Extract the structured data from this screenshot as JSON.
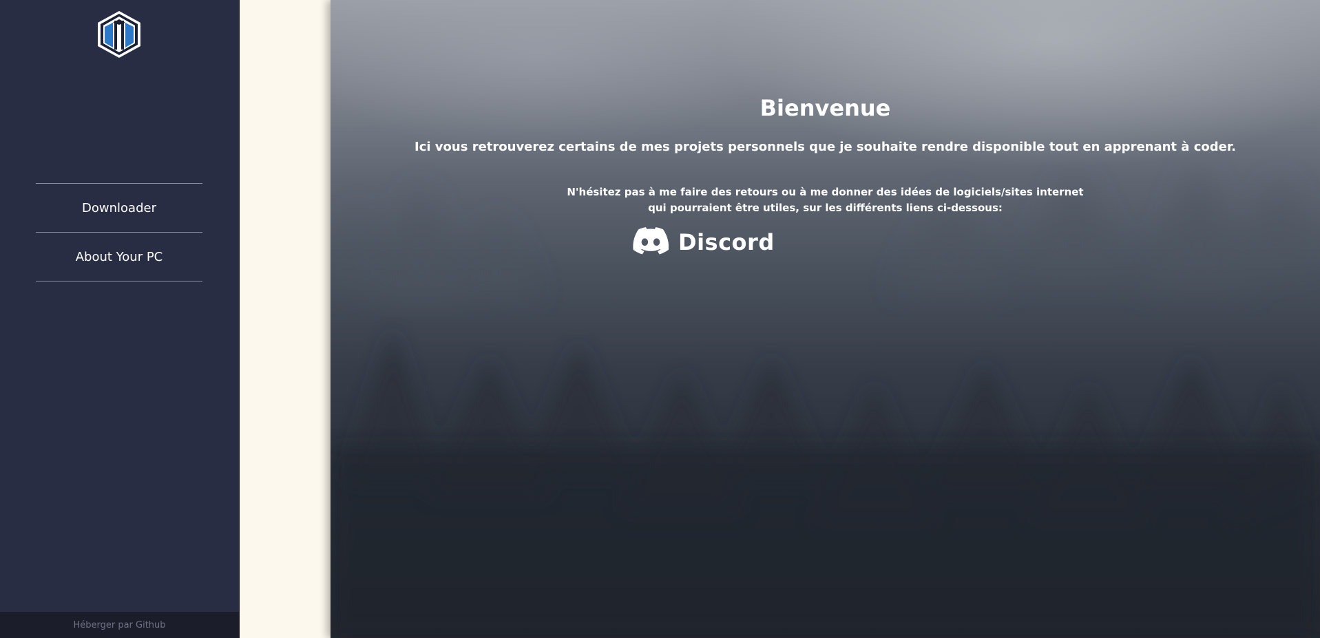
{
  "sidebar": {
    "logo_icon": "hexagon-logo-icon",
    "nav_items": [
      {
        "label": "Downloader"
      },
      {
        "label": "About Your PC"
      }
    ],
    "footer_text": "Héberger par Github"
  },
  "main": {
    "title": "Bienvenue",
    "subtitle": "Ici vous retrouverez certains de mes projets personnels que je souhaite rendre disponible tout en apprenant à coder.",
    "note_line1": "N'hésitez pas à me faire des retours ou à me donner des idées de logiciels/sites internet",
    "note_line2": "qui pourraient être utiles, sur les différents liens ci-dessous:",
    "discord_label": "Discord",
    "discord_icon": "discord-icon"
  },
  "colors": {
    "sidebar_bg": "#292d44",
    "footer_bg": "#1b1d2a",
    "cream_bg": "#fdf8ee",
    "text": "#ffffff"
  }
}
